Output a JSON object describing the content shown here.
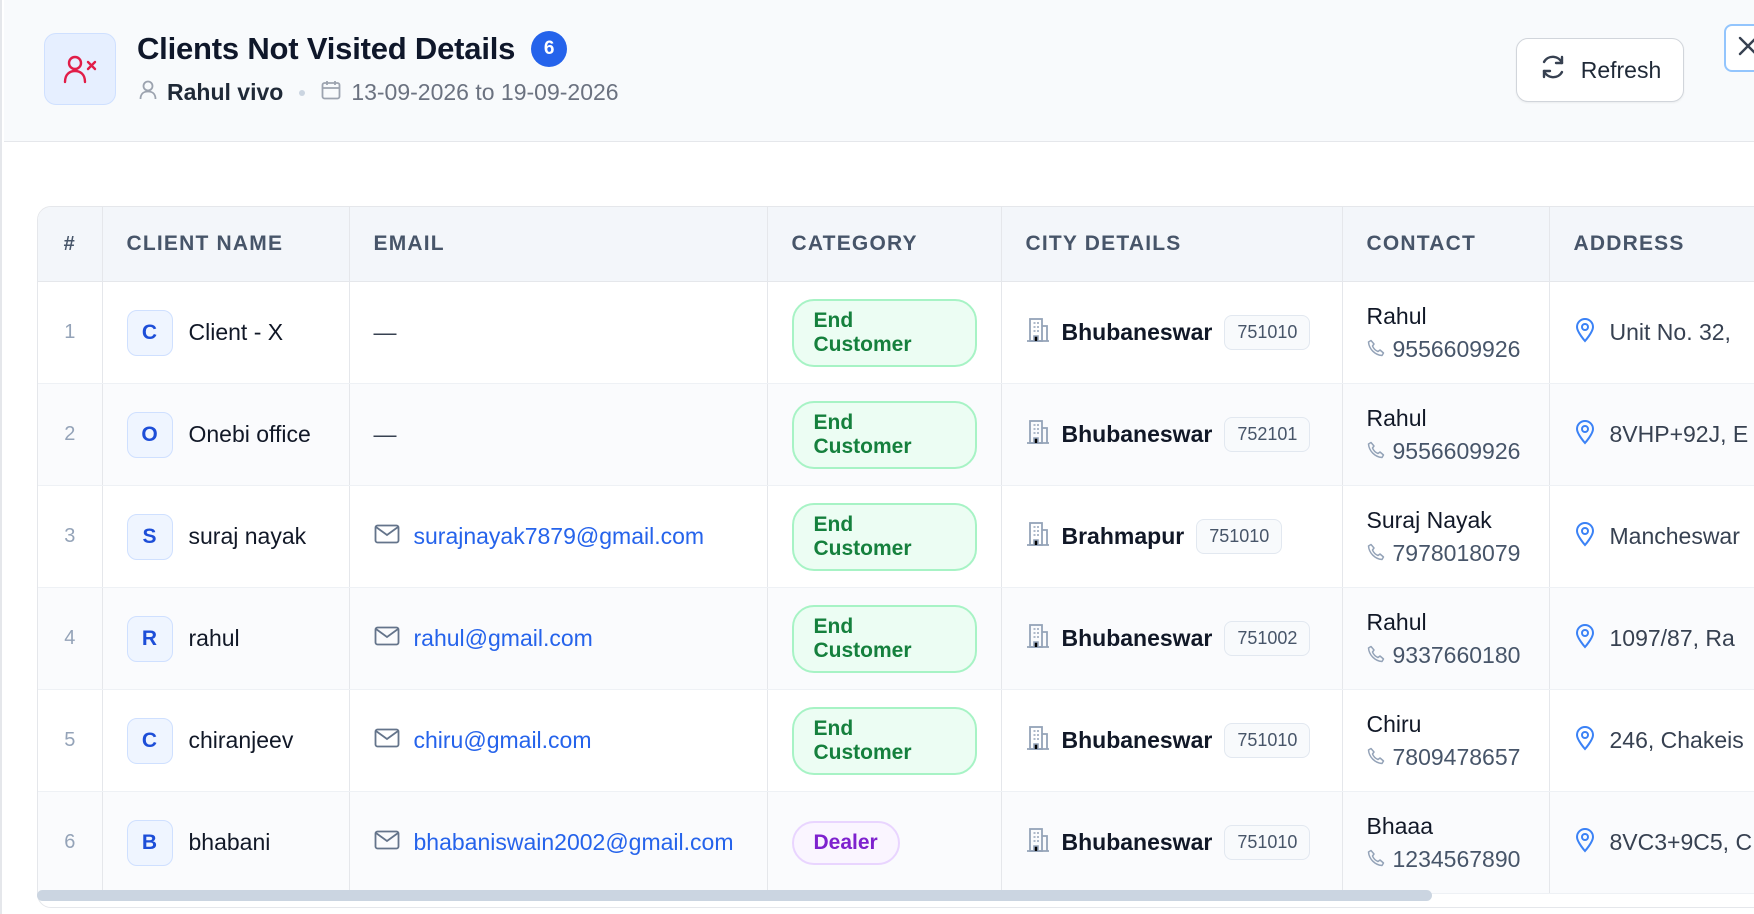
{
  "header": {
    "title": "Clients Not Visited Details",
    "count": "6",
    "user": "Rahul vivo",
    "date_range": "13-09-2026 to 19-09-2026",
    "refresh_label": "Refresh"
  },
  "colors": {
    "accent": "#2563eb",
    "end_customer": "#15803d",
    "dealer": "#7e22ce",
    "header_icon": "#e11d48"
  },
  "table": {
    "columns": [
      "#",
      "CLIENT NAME",
      "EMAIL",
      "CATEGORY",
      "CITY DETAILS",
      "CONTACT",
      "ADDRESS"
    ],
    "rows": [
      {
        "idx": "1",
        "initial": "C",
        "name": "Client - X",
        "email": "—",
        "has_email": false,
        "category": "End Customer",
        "category_type": "end",
        "city": "Bhubaneswar",
        "pin": "751010",
        "contact_name": "Rahul",
        "phone": "9556609926",
        "address": "Unit No. 32, "
      },
      {
        "idx": "2",
        "initial": "O",
        "name": "Onebi office",
        "email": "—",
        "has_email": false,
        "category": "End Customer",
        "category_type": "end",
        "city": "Bhubaneswar",
        "pin": "752101",
        "contact_name": "Rahul",
        "phone": "9556609926",
        "address": "8VHP+92J, E"
      },
      {
        "idx": "3",
        "initial": "S",
        "name": "suraj nayak",
        "email": "surajnayak7879@gmail.com",
        "has_email": true,
        "category": "End Customer",
        "category_type": "end",
        "city": "Brahmapur",
        "pin": "751010",
        "contact_name": "Suraj Nayak",
        "phone": "7978018079",
        "address": "Mancheswar"
      },
      {
        "idx": "4",
        "initial": "R",
        "name": "rahul",
        "email": "rahul@gmail.com",
        "has_email": true,
        "category": "End Customer",
        "category_type": "end",
        "city": "Bhubaneswar",
        "pin": "751002",
        "contact_name": "Rahul",
        "phone": "9337660180",
        "address": "1097/87, Ra"
      },
      {
        "idx": "5",
        "initial": "C",
        "name": "chiranjeev",
        "email": "chiru@gmail.com",
        "has_email": true,
        "category": "End Customer",
        "category_type": "end",
        "city": "Bhubaneswar",
        "pin": "751010",
        "contact_name": "Chiru",
        "phone": "7809478657",
        "address": "246, Chakeis"
      },
      {
        "idx": "6",
        "initial": "B",
        "name": "bhabani",
        "email": "bhabaniswain2002@gmail.com",
        "has_email": true,
        "category": "Dealer",
        "category_type": "dealer",
        "city": "Bhubaneswar",
        "pin": "751010",
        "contact_name": "Bhaaa",
        "phone": "1234567890",
        "address": "8VC3+9C5, C"
      }
    ]
  }
}
